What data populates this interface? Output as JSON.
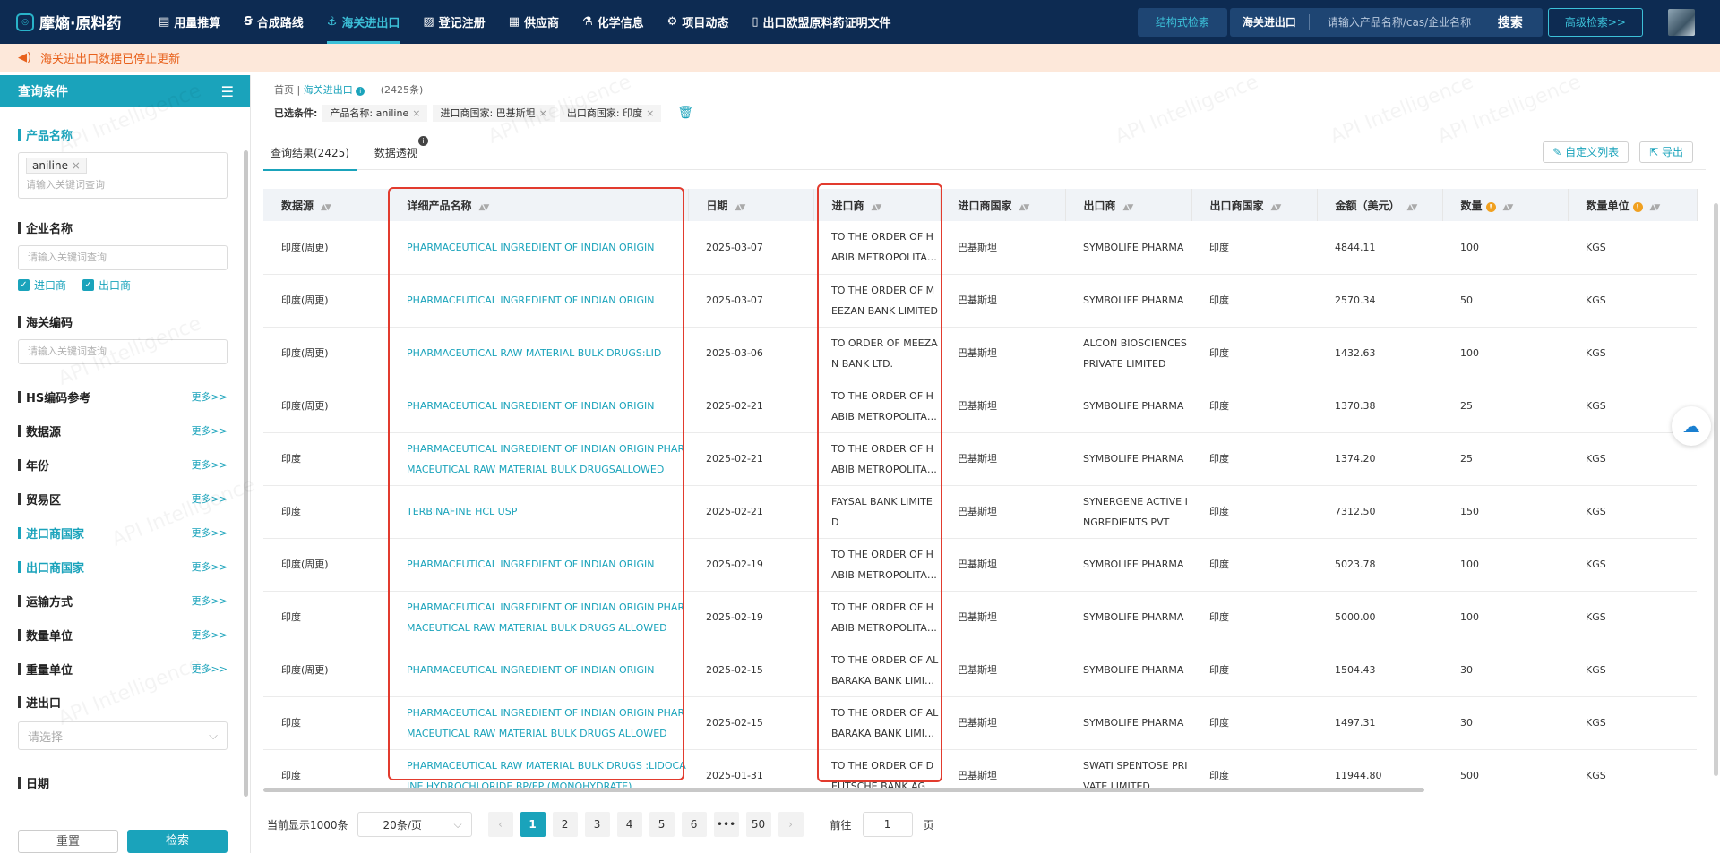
{
  "brand": {
    "name": "摩熵·原料药"
  },
  "nav": [
    {
      "label": "用量推算",
      "icon": "bar-chart-icon",
      "glyph": "▤"
    },
    {
      "label": "合成路线",
      "icon": "route-icon",
      "glyph": "Ꞩ"
    },
    {
      "label": "海关进出口",
      "icon": "anchor-icon",
      "glyph": "⚓",
      "active": true
    },
    {
      "label": "登记注册",
      "icon": "register-icon",
      "glyph": "▨"
    },
    {
      "label": "供应商",
      "icon": "supplier-icon",
      "glyph": "▦"
    },
    {
      "label": "化学信息",
      "icon": "flask-icon",
      "glyph": "⚗"
    },
    {
      "label": "项目动态",
      "icon": "project-icon",
      "glyph": "⚙"
    },
    {
      "label": "出口欧盟原料药证明文件",
      "icon": "document-icon",
      "glyph": "▯"
    }
  ],
  "topbar": {
    "struct_search": "结构式检索",
    "search_category": "海关进出口",
    "search_placeholder": "请输入产品名称/cas/企业名称",
    "search_button": "搜索",
    "advanced": "高级检索>>"
  },
  "notice": {
    "text": "海关进出口数据已停止更新"
  },
  "sidebar": {
    "title": "查询条件",
    "product_name": {
      "title": "产品名称",
      "tag": "aniline",
      "placeholder": "请输入关键词查询"
    },
    "company_name": {
      "title": "企业名称",
      "placeholder": "请输入关键词查询",
      "checks": [
        "进口商",
        "出口商"
      ]
    },
    "customs_code": {
      "title": "海关编码",
      "placeholder": "请输入关键词查询"
    },
    "more_label": "更多>>",
    "sections": [
      {
        "title": "HS编码参考",
        "highlight": false
      },
      {
        "title": "数据源",
        "highlight": false
      },
      {
        "title": "年份",
        "highlight": false
      },
      {
        "title": "贸易区",
        "highlight": false
      },
      {
        "title": "进口商国家",
        "highlight": true
      },
      {
        "title": "出口商国家",
        "highlight": true
      },
      {
        "title": "运输方式",
        "highlight": false
      },
      {
        "title": "数量单位",
        "highlight": false
      },
      {
        "title": "重量单位",
        "highlight": false
      }
    ],
    "import_export": {
      "title": "进出口",
      "placeholder": "请选择"
    },
    "date": {
      "title": "日期"
    },
    "reset": "重置",
    "search": "检索"
  },
  "breadcrumb": {
    "home": "首页",
    "current": "海关进出口",
    "count": "(2425条)"
  },
  "filters": {
    "label": "已选条件:",
    "chips": [
      "产品名称: aniline",
      "进口商国家: 巴基斯坦",
      "出口商国家: 印度"
    ]
  },
  "tabs": [
    {
      "label": "查询结果(2425)",
      "active": true
    },
    {
      "label": "数据透视",
      "active": false
    }
  ],
  "tools": {
    "custom_columns": "自定义列表",
    "export": "导出"
  },
  "table": {
    "columns": [
      "数据源",
      "详细产品名称",
      "日期",
      "进口商",
      "进口商国家",
      "出口商",
      "出口商国家",
      "金额（美元）",
      "数量",
      "数量单位"
    ],
    "rows": [
      [
        "印度(周更)",
        "PHARMACEUTICAL INGREDIENT OF INDIAN ORIGIN",
        "2025-03-07",
        "TO THE ORDER OF HABIB METROPOLITAN BANK",
        "巴基斯坦",
        "SYMBOLIFE PHARMA",
        "印度",
        "4844.11",
        "100",
        "KGS"
      ],
      [
        "印度(周更)",
        "PHARMACEUTICAL INGREDIENT OF INDIAN ORIGIN",
        "2025-03-07",
        "TO THE ORDER OF MEEZAN BANK LIMITED",
        "巴基斯坦",
        "SYMBOLIFE PHARMA",
        "印度",
        "2570.34",
        "50",
        "KGS"
      ],
      [
        "印度(周更)",
        "PHARMACEUTICAL RAW MATERIAL BULK DRUGS:LID",
        "2025-03-06",
        "TO ORDER OF MEEZAN BANK LTD.",
        "巴基斯坦",
        "ALCON BIOSCIENCES PRIVATE LIMITED",
        "印度",
        "1432.63",
        "100",
        "KGS"
      ],
      [
        "印度(周更)",
        "PHARMACEUTICAL INGREDIENT OF INDIAN ORIGIN",
        "2025-02-21",
        "TO THE ORDER OF HABIB METROPOLITAN BANK",
        "巴基斯坦",
        "SYMBOLIFE PHARMA",
        "印度",
        "1370.38",
        "25",
        "KGS"
      ],
      [
        "印度",
        "PHARMACEUTICAL INGREDIENT OF INDIAN ORIGIN PHARMACEUTICAL RAW MATERIAL BULK DRUGSALLOWED",
        "2025-02-21",
        "TO THE ORDER OF HABIB METROPOLITAN BANK",
        "巴基斯坦",
        "SYMBOLIFE PHARMA",
        "印度",
        "1374.20",
        "25",
        "KGS"
      ],
      [
        "印度",
        "TERBINAFINE HCL USP",
        "2025-02-21",
        "FAYSAL BANK LIMITED",
        "巴基斯坦",
        "SYNERGENE ACTIVE INGREDIENTS PVT",
        "印度",
        "7312.50",
        "150",
        "KGS"
      ],
      [
        "印度(周更)",
        "PHARMACEUTICAL INGREDIENT OF INDIAN ORIGIN",
        "2025-02-19",
        "TO THE ORDER OF HABIB METROPOLITAN BANK",
        "巴基斯坦",
        "SYMBOLIFE PHARMA",
        "印度",
        "5023.78",
        "100",
        "KGS"
      ],
      [
        "印度",
        "PHARMACEUTICAL INGREDIENT OF INDIAN ORIGIN PHARMACEUTICAL RAW MATERIAL BULK DRUGS ALLOWED",
        "2025-02-19",
        "TO THE ORDER OF HABIB METROPOLITAN BANK",
        "巴基斯坦",
        "SYMBOLIFE PHARMA",
        "印度",
        "5000.00",
        "100",
        "KGS"
      ],
      [
        "印度(周更)",
        "PHARMACEUTICAL INGREDIENT OF INDIAN ORIGIN",
        "2025-02-15",
        "TO THE ORDER OF AL BARAKA BANK LIMITED",
        "巴基斯坦",
        "SYMBOLIFE PHARMA",
        "印度",
        "1504.43",
        "30",
        "KGS"
      ],
      [
        "印度",
        "PHARMACEUTICAL INGREDIENT OF INDIAN ORIGIN PHARMACEUTICAL RAW MATERIAL BULK DRUGS ALLOWED",
        "2025-02-15",
        "TO THE ORDER OF AL BARAKA BANK LIMITED",
        "巴基斯坦",
        "SYMBOLIFE PHARMA",
        "印度",
        "1497.31",
        "30",
        "KGS"
      ],
      [
        "印度",
        "PHARMACEUTICAL RAW MATERIAL BULK DRUGS :LIDOCAINE HYDROCHLORIDE BP/EP (MONOHYDRATE)",
        "2025-01-31",
        "TO THE ORDER OF DEUTSCHE BANK AG",
        "巴基斯坦",
        "SWATI SPENTOSE PRIVATE LIMITED",
        "印度",
        "11944.80",
        "500",
        "KGS"
      ]
    ]
  },
  "pagination": {
    "showing": "当前显示1000条",
    "page_size": "20条/页",
    "prev": "‹",
    "pages": [
      "1",
      "2",
      "3",
      "4",
      "5",
      "6",
      "•••",
      "50"
    ],
    "next": "›",
    "goto_label": "前往",
    "goto_value": "1",
    "page_unit": "页"
  },
  "watermark": "API Intelligence",
  "colors": {
    "nav_bg": "#0d2b52",
    "accent": "#1aa3bb",
    "highlight_box": "#e23b2e",
    "notice_bg": "#fde8da",
    "notice_text": "#e8611c"
  }
}
